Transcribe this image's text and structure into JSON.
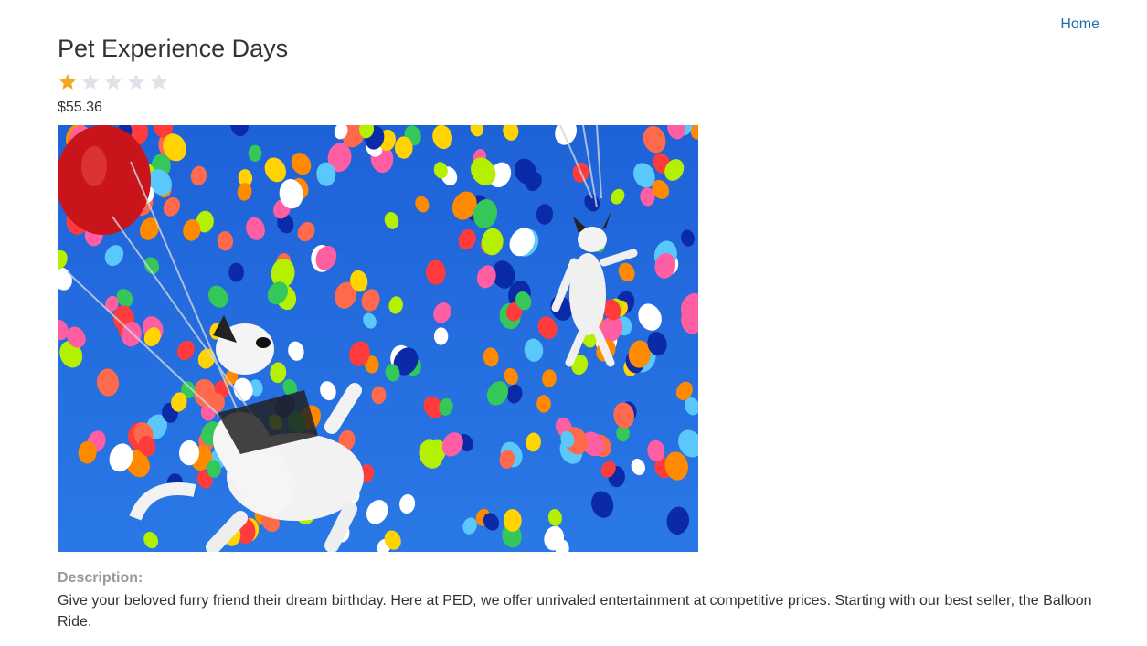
{
  "nav": {
    "home_label": "Home"
  },
  "product": {
    "title": "Pet Experience Days",
    "rating": {
      "value": 1,
      "max": 5,
      "filled_color": "#f5a623",
      "empty_color": "#dde3e8"
    },
    "price": "$55.36",
    "image": {
      "subject": "dogs-floating-with-colorful-balloons"
    },
    "description_label": "Description:",
    "description_text": "Give your beloved furry friend their dream birthday. Here at PED, we offer unrivaled entertainment at competitive prices. Starting with our best seller, the Balloon Ride."
  }
}
